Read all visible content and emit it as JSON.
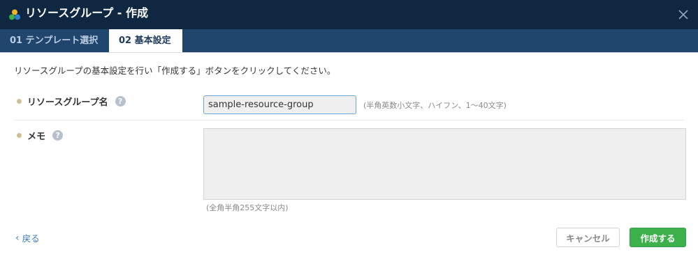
{
  "dialog": {
    "title": "リソースグループ - 作成",
    "app_icon": "resource-group-icon",
    "close_icon": "close-icon"
  },
  "tabs": [
    {
      "label": "01 テンプレート選択",
      "active": false
    },
    {
      "label": "02 基本設定",
      "active": true
    }
  ],
  "instruction": "リソースグループの基本設定を行い「作成する」ボタンをクリックしてください。",
  "form": {
    "name": {
      "label": "リソースグループ名",
      "value": "sample-resource-group",
      "hint": "(半角英数小文字、ハイフン、1～40文字)",
      "help_icon": "?"
    },
    "memo": {
      "label": "メモ",
      "value": "",
      "hint": "(全角半角255文字以内)",
      "help_icon": "?"
    }
  },
  "footer": {
    "back_label": "戻る",
    "cancel_label": "キャンセル",
    "create_label": "作成する"
  },
  "colors": {
    "titlebar": "#0f2741",
    "tabbar": "#20466d",
    "primary_button": "#3cb04a",
    "link": "#3a7fc1"
  }
}
